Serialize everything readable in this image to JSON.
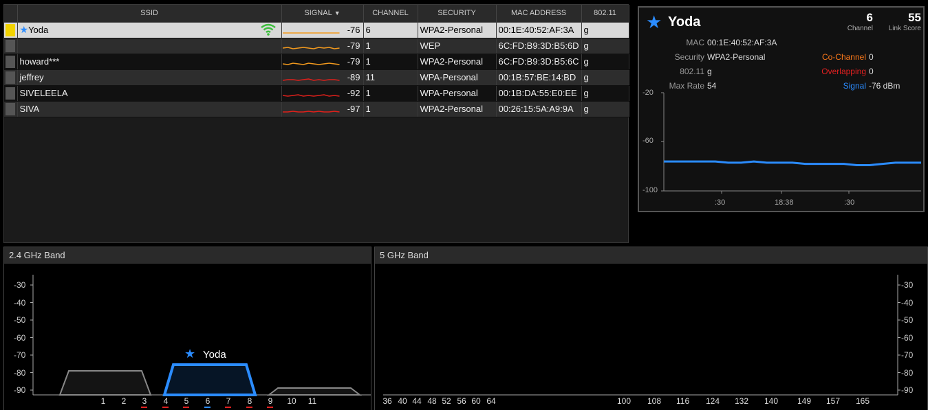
{
  "table": {
    "headers": [
      "SSID",
      "SIGNAL",
      "CHANNEL",
      "SECURITY",
      "MAC ADDRESS",
      "802.11"
    ],
    "sort_icon": "triangle-down-icon",
    "rows": [
      {
        "ssid": "Yoda",
        "starred": true,
        "signal": "-76",
        "channel": "6",
        "security": "WPA2-Personal",
        "mac": "00:1E:40:52:AF:3A",
        "phy": "g",
        "trace_color": "#f39a1e",
        "selected": true
      },
      {
        "ssid": "",
        "starred": false,
        "signal": "-79",
        "channel": "1",
        "security": "WEP",
        "mac": "6C:FD:B9:3D:B5:6D",
        "phy": "g",
        "trace_color": "#f39a1e",
        "selected": false
      },
      {
        "ssid": "howard***",
        "starred": false,
        "signal": "-79",
        "channel": "1",
        "security": "WPA2-Personal",
        "mac": "6C:FD:B9:3D:B5:6C",
        "phy": "g",
        "trace_color": "#f39a1e",
        "selected": false
      },
      {
        "ssid": "jeffrey",
        "starred": false,
        "signal": "-89",
        "channel": "11",
        "security": "WPA-Personal",
        "mac": "00:1B:57:BE:14:BD",
        "phy": "g",
        "trace_color": "#e0201b",
        "selected": false
      },
      {
        "ssid": "SIVELEELA",
        "starred": false,
        "signal": "-92",
        "channel": "1",
        "security": "WPA-Personal",
        "mac": "00:1B:DA:55:E0:EE",
        "phy": "g",
        "trace_color": "#e0201b",
        "selected": false
      },
      {
        "ssid": "SIVA",
        "starred": false,
        "signal": "-97",
        "channel": "1",
        "security": "WPA2-Personal",
        "mac": "00:26:15:5A:A9:9A",
        "phy": "g",
        "trace_color": "#e0201b",
        "selected": false
      }
    ]
  },
  "details": {
    "name": "Yoda",
    "channel_value": "6",
    "channel_label": "Channel",
    "link_score_value": "55",
    "link_score_label": "Link Score",
    "mac_label": "MAC",
    "mac": "00:1E:40:52:AF:3A",
    "security_label": "Security",
    "security": "WPA2-Personal",
    "phy_label": "802.11",
    "phy": "g",
    "max_rate_label": "Max Rate",
    "max_rate": "54",
    "co_channel_label": "Co-Channel",
    "co_channel": "0",
    "overlapping_label": "Overlapping",
    "overlapping": "0",
    "signal_label": "Signal",
    "signal": "-76 dBm",
    "colors": {
      "co_channel": "#ff7a1a",
      "overlapping": "#e02020",
      "signal": "#2b8cff"
    },
    "chart": {
      "y_ticks": [
        "-20",
        "-60",
        "-100"
      ],
      "x_ticks": [
        ":30",
        "18:38",
        ":30"
      ]
    }
  },
  "band24": {
    "title": "2.4 GHz Band",
    "y_ticks": [
      "-30",
      "-40",
      "-50",
      "-60",
      "-70",
      "-80",
      "-90"
    ],
    "channels": [
      "1",
      "2",
      "3",
      "4",
      "5",
      "6",
      "7",
      "8",
      "9",
      "10",
      "11"
    ],
    "ap_label": "Yoda"
  },
  "band5": {
    "title": "5 GHz Band",
    "y_ticks": [
      "-30",
      "-40",
      "-50",
      "-60",
      "-70",
      "-80",
      "-90"
    ],
    "channels": [
      "36",
      "40",
      "44",
      "48",
      "52",
      "56",
      "60",
      "64",
      "100",
      "108",
      "116",
      "124",
      "132",
      "140",
      "149",
      "157",
      "165"
    ]
  },
  "chart_data": [
    {
      "type": "line",
      "title": "",
      "series": [
        {
          "name": "Signal",
          "x_labels": [
            ":30",
            "18:38",
            ":30"
          ],
          "values": [
            -76,
            -76,
            -76,
            -76,
            -76,
            -77,
            -77,
            -76,
            -77,
            -77,
            -77,
            -78,
            -78,
            -78,
            -78,
            -79,
            -79,
            -78,
            -77,
            -77,
            -77
          ]
        }
      ],
      "ylim": [
        -100,
        -20
      ],
      "y_ticks": [
        -20,
        -60,
        -100
      ],
      "color": "#2b8cff"
    },
    {
      "type": "area",
      "title": "2.4 GHz Band",
      "ylim": [
        -95,
        -25
      ],
      "networks": [
        {
          "name": "howard***",
          "channel": 1,
          "signal": -79,
          "color": "#888888"
        },
        {
          "name": "Yoda",
          "channel": 6,
          "signal": -76,
          "color": "#2b8cff"
        },
        {
          "name": "jeffrey",
          "channel": 11,
          "signal": -89,
          "color": "#888888"
        }
      ]
    }
  ]
}
